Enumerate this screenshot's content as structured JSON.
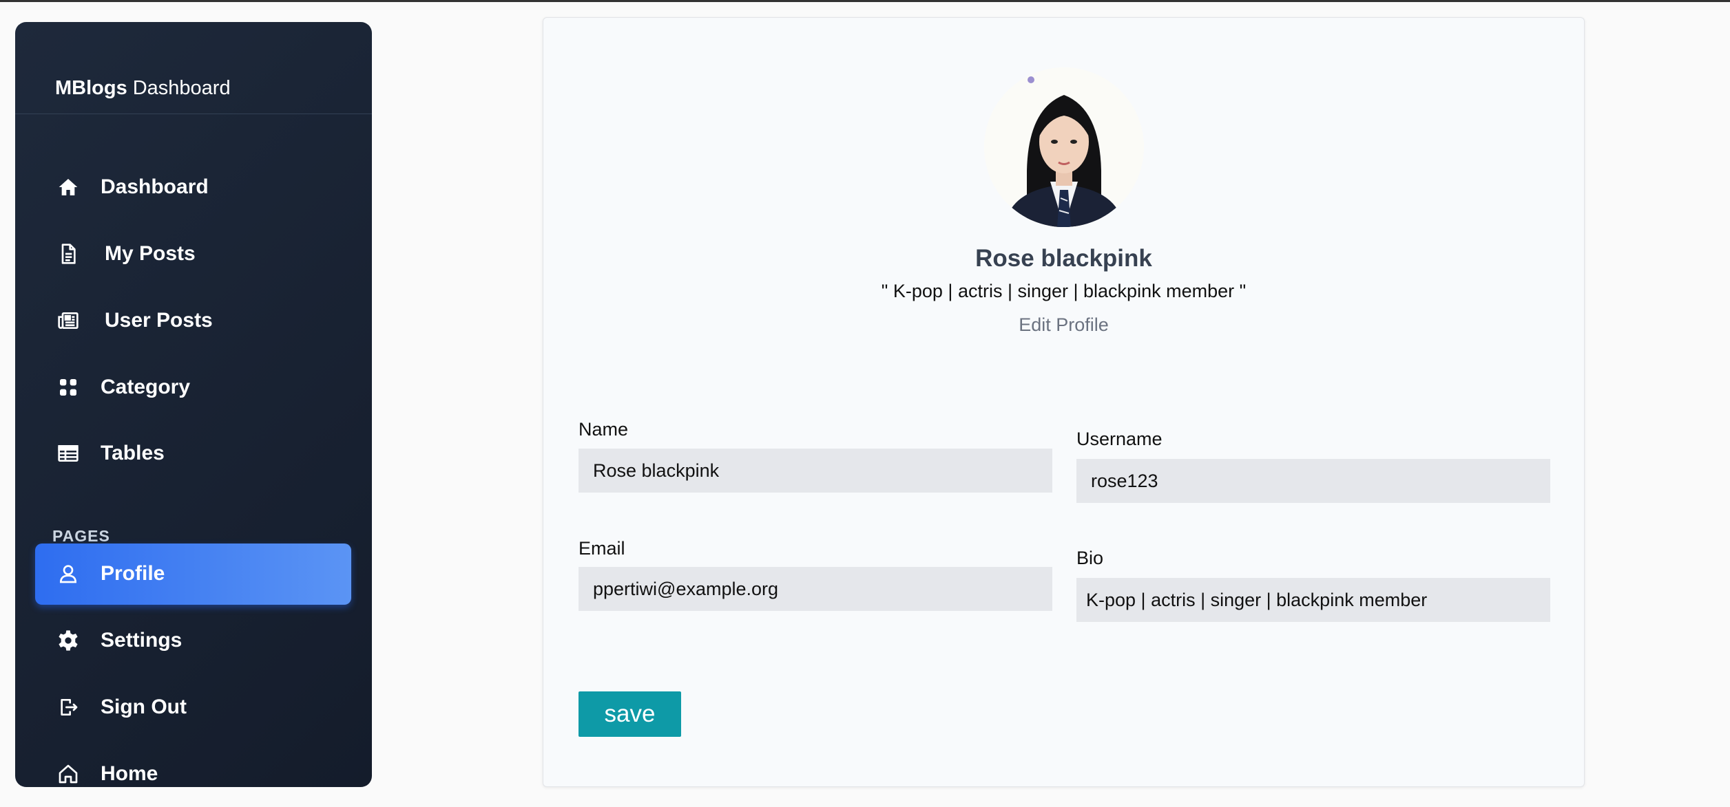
{
  "brand": {
    "name_bold": "MBlogs",
    "name_rest": "Dashboard"
  },
  "sidebar": {
    "items": [
      {
        "label": "Dashboard",
        "icon": "home-icon"
      },
      {
        "label": "My Posts",
        "icon": "document-icon"
      },
      {
        "label": "User Posts",
        "icon": "newspaper-icon"
      },
      {
        "label": "Category",
        "icon": "grid-icon"
      },
      {
        "label": "Tables",
        "icon": "table-icon"
      }
    ],
    "section_label": "PAGES",
    "pages": [
      {
        "label": "Profile",
        "icon": "user-icon",
        "active": true
      },
      {
        "label": "Settings",
        "icon": "gear-icon"
      },
      {
        "label": "Sign Out",
        "icon": "sign-out-icon"
      },
      {
        "label": "Home",
        "icon": "home-outline-icon"
      }
    ]
  },
  "colors": {
    "sidebar_bg": "#1e293b",
    "active": "#3b82f6",
    "save": "#0e9aa7"
  },
  "profile": {
    "name": "Rose blackpink",
    "bio_quote": "\" K-pop | actris | singer | blackpink member \"",
    "edit_label": "Edit Profile"
  },
  "form": {
    "name_label": "Name",
    "name_value": "Rose blackpink",
    "username_label": "Username",
    "username_value": "rose123",
    "email_label": "Email",
    "email_value": "ppertiwi@example.org",
    "bio_label": "Bio",
    "bio_value": "K-pop | actris | singer | blackpink member",
    "save_label": "save"
  }
}
